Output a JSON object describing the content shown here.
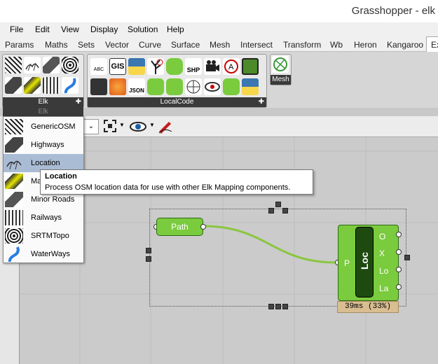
{
  "window": {
    "title": "Grasshopper - elk"
  },
  "menubar": {
    "items": [
      "File",
      "Edit",
      "View",
      "Display",
      "Solution",
      "Help"
    ]
  },
  "tabs": {
    "items": [
      "Params",
      "Maths",
      "Sets",
      "Vector",
      "Curve",
      "Surface",
      "Mesh",
      "Intersect",
      "Transform",
      "Wb",
      "Heron",
      "Kangaroo",
      "Ex"
    ]
  },
  "ribbon": {
    "elk_panel_label": "Elk",
    "localcode_panel_label": "LocalCode",
    "mesh_label": "Mesh",
    "elk_dropdown_label": "Elk"
  },
  "icons_text": {
    "abc": "ABC",
    "gis": "GIS",
    "shp": "SHP",
    "json": "JSON"
  },
  "elk_menu": {
    "items": [
      "GenericOSM",
      "Highways",
      "Location",
      "Ma",
      "Minor Roads",
      "Railways",
      "SRTMTopo",
      "WaterWays"
    ],
    "selected": "Location"
  },
  "tooltip": {
    "title": "Location",
    "description": "Process OSM location data for use with other Elk Mapping components."
  },
  "canvas": {
    "path_node_label": "Path",
    "loc_node_label": "Loc",
    "loc_input": "P",
    "loc_outputs": [
      "O",
      "X",
      "Lo",
      "La"
    ],
    "timing": "39ms (33%)"
  },
  "colors": {
    "node_green": "#7acb3d",
    "wire_green": "#8ac640",
    "timing_bg": "#d9be92"
  }
}
